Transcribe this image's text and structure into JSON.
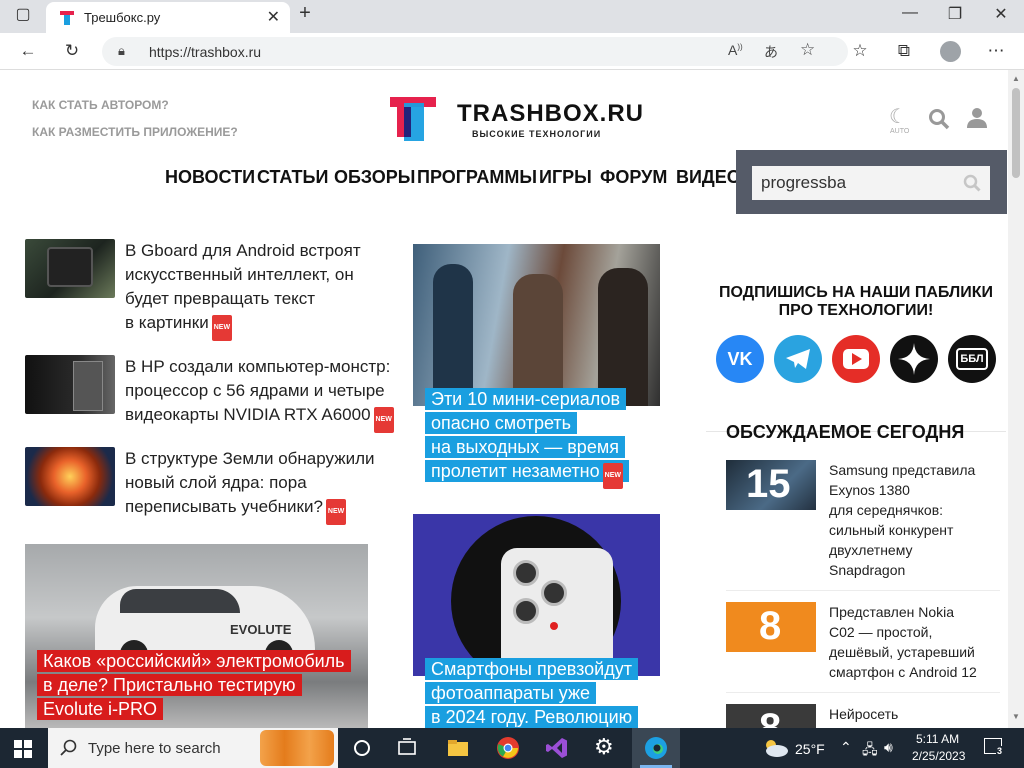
{
  "browser": {
    "tab_title": "Трешбокс.ру",
    "url": "https://trashbox.ru"
  },
  "header": {
    "link_author": "КАК СТАТЬ АВТОРОМ?",
    "link_app": "КАК РАЗМЕСТИТЬ ПРИЛОЖЕНИЕ?",
    "brand": "TRASHBOX.RU",
    "tagline": "ВЫСОКИЕ ТЕХНОЛОГИИ",
    "auto_label": "AUTO"
  },
  "nav": [
    "НОВОСТИ",
    "СТАТЬИ",
    "ОБЗОРЫ",
    "ПРОГРАММЫ",
    "ИГРЫ",
    "ФОРУМ",
    "ВИДЕО"
  ],
  "search": {
    "value": "progressba"
  },
  "news": [
    {
      "lines": [
        "В Gboard для Android встроят",
        "искусственный интеллект, он",
        "будет превращать текст",
        "в картинки"
      ],
      "badge": "NEW"
    },
    {
      "lines": [
        "В HP создали компьютер-монстр:",
        "процессор с 56 ядрами и четыре",
        "видеокарты NVIDIA RTX A6000"
      ],
      "badge": "NEW"
    },
    {
      "lines": [
        "В структуре Земли обнаружили",
        "новый слой ядра: пора",
        "переписывать учебники?"
      ],
      "badge": "NEW"
    }
  ],
  "cards": {
    "series": {
      "lines": [
        "Эти 10 мини-сериалов",
        "опасно смотреть",
        "на выходных — время",
        "пролетит незаметно"
      ],
      "badge": "NEW"
    },
    "car": {
      "lines": [
        "Каков «российский» электромобиль",
        "в деле? Пристально тестирую",
        "Evolute i-PRO"
      ],
      "car_label": "EVOLUTE"
    },
    "phone": {
      "lines": [
        "Смартфоны превзойдут",
        "фотоаппараты уже",
        "в 2024 году. Революцию"
      ]
    }
  },
  "sidebar": {
    "subscribe_title": "ПОДПИШИСЬ НА НАШИ ПАБЛИКИ ПРО ТЕХНОЛОГИИ!",
    "socials": [
      "vk",
      "telegram",
      "youtube",
      "dzen",
      "ББЛ"
    ],
    "discussed_title": "ОБСУЖДАЕМОЕ СЕГОДНЯ",
    "discussed": [
      {
        "count": "15",
        "text": [
          "Samsung представила",
          "Exynos 1380",
          "для середнячков:",
          "сильный конкурент",
          "двухлетнему",
          "Snapdragon"
        ]
      },
      {
        "count": "8",
        "text": [
          "Представлен Nokia",
          "C02 — простой,",
          "дешёвый, устаревший",
          "смартфон с Android 12"
        ]
      },
      {
        "count": "8",
        "text": [
          "Нейросеть"
        ]
      }
    ]
  },
  "taskbar": {
    "search_placeholder": "Type here to search",
    "weather": "25°F",
    "time": "5:11 AM",
    "date": "2/25/2023",
    "notif_count": "3"
  },
  "colors": {
    "accent_blue": "#1a9fe0",
    "accent_red": "#d81c1c",
    "search_panel": "#555b68",
    "taskbar": "#1c2733"
  }
}
